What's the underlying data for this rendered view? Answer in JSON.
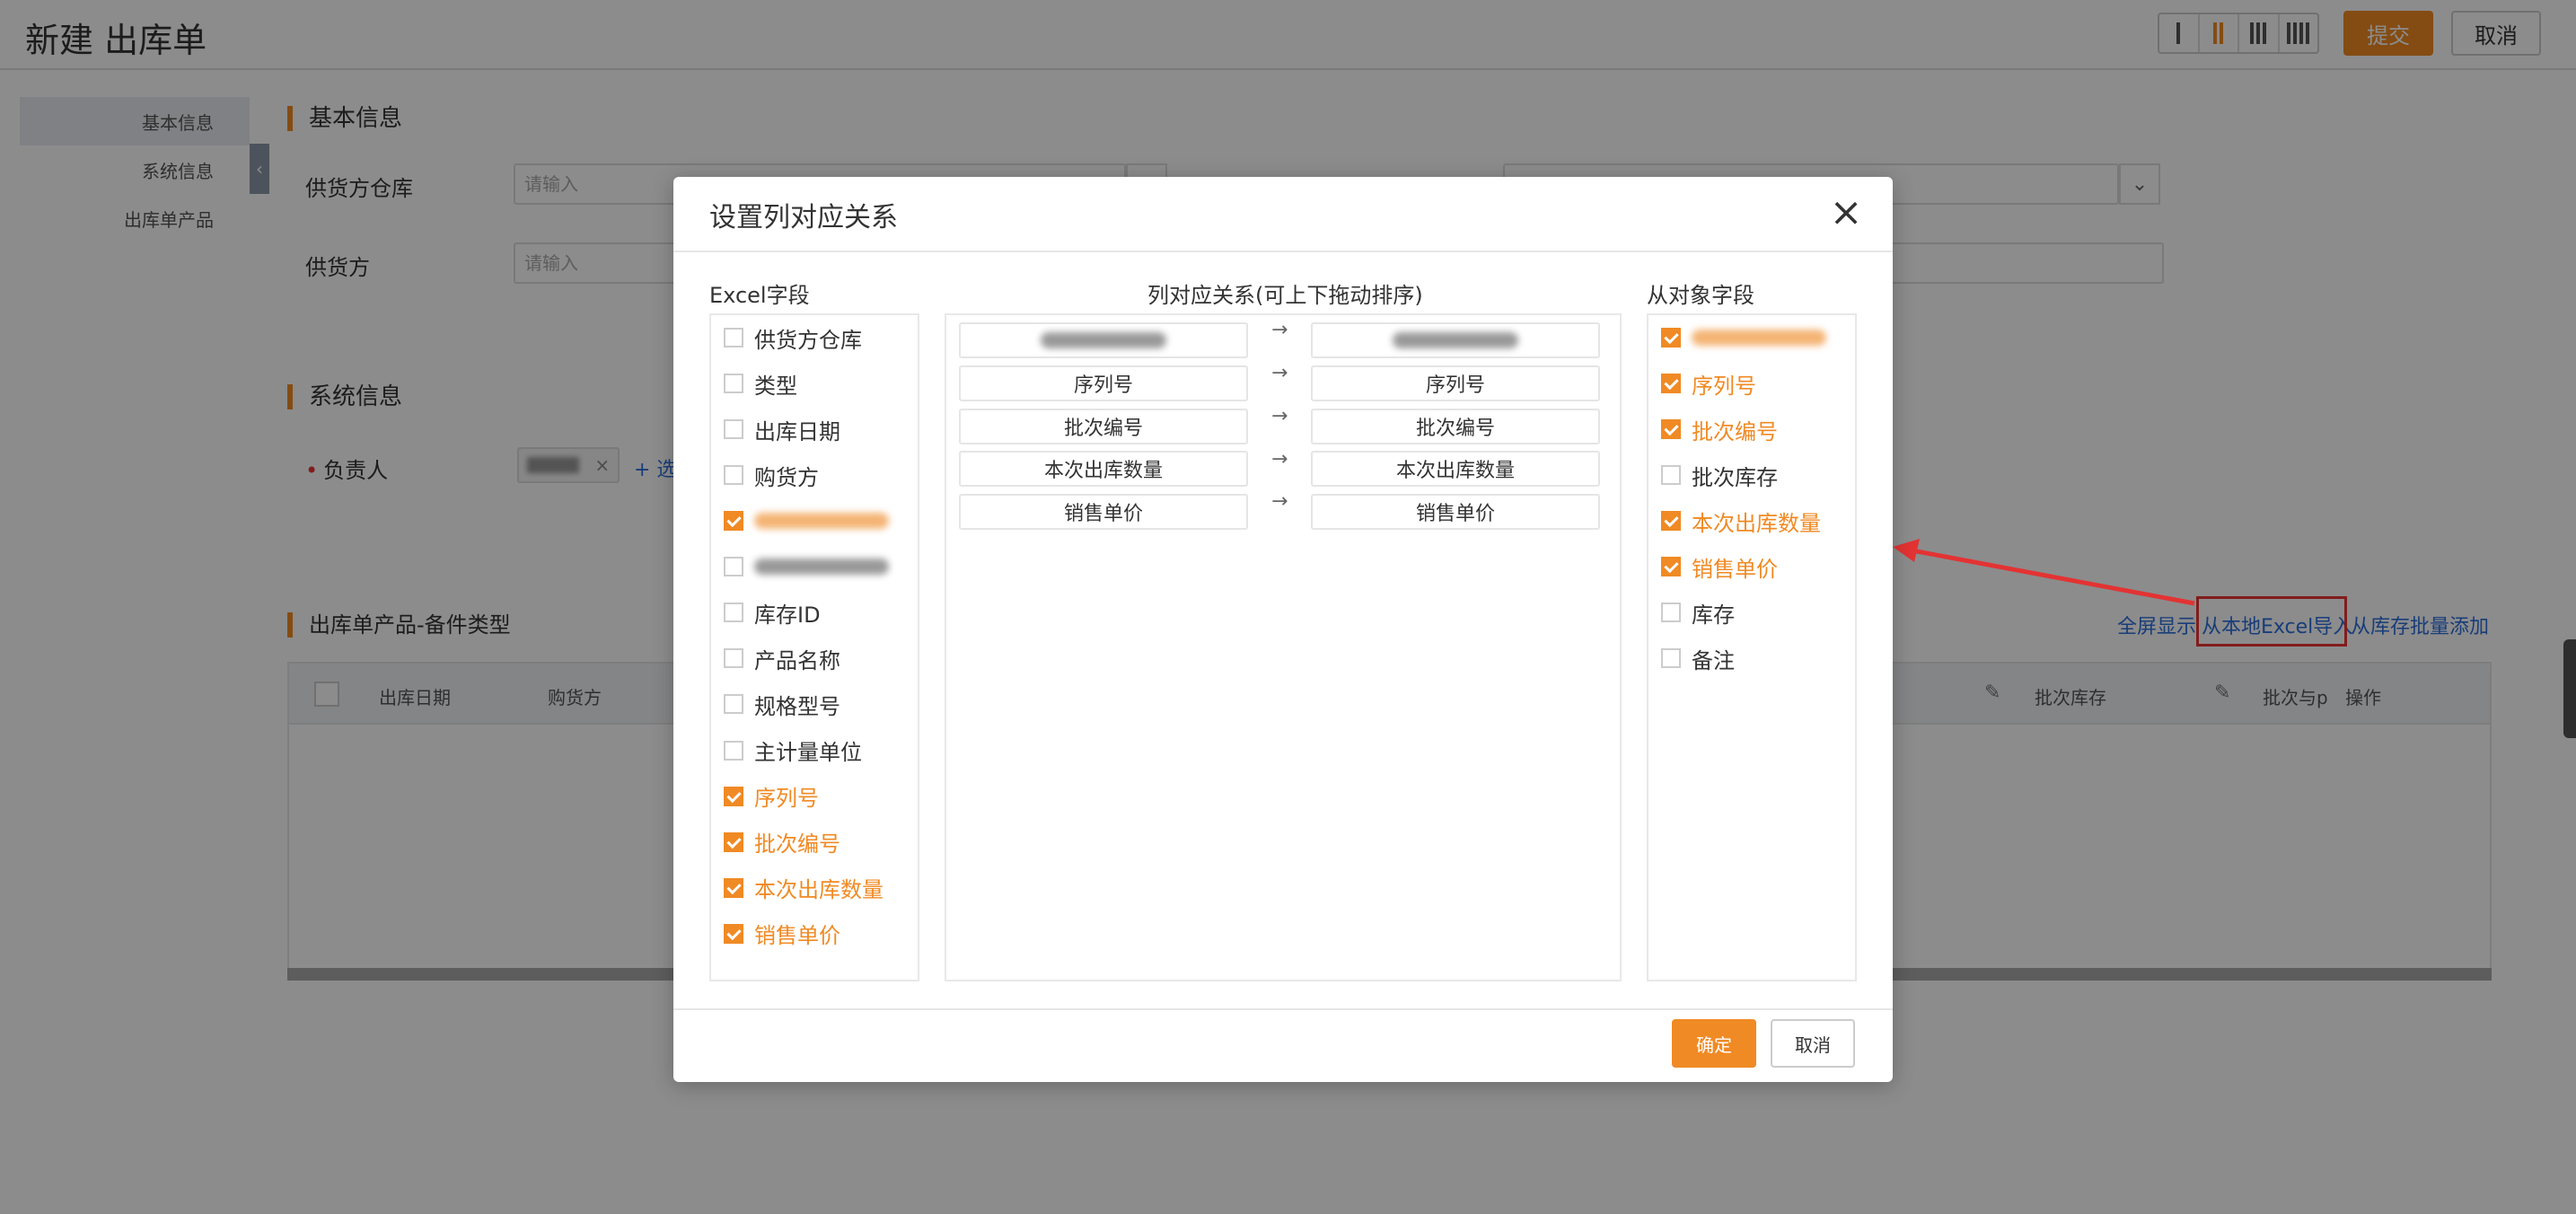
{
  "header": {
    "title": "新建 出库单",
    "submit_label": "提交",
    "cancel_label": "取消"
  },
  "side_nav": [
    "基本信息",
    "系统信息",
    "出库单产品"
  ],
  "collapse_icon": "‹",
  "sections": {
    "basic": "基本信息",
    "system": "系统信息",
    "products": "出库单产品-备件类型"
  },
  "form": {
    "supplier_warehouse_label": "供货方仓库",
    "supplier_label": "供货方",
    "placeholder": "请输入",
    "owner_label": "负责人",
    "required_mark": "•",
    "add_link": "+ 选",
    "tag_close": "×"
  },
  "product_links": {
    "fullscreen": "全屏显示",
    "import_excel": "从本地Excel导入",
    "batch_add": "从库存批量添加"
  },
  "table_headers": {
    "date": "出库日期",
    "buyer": "购货方",
    "batch_stock": "批次库存",
    "batch_and": "批次与p",
    "ops": "操作"
  },
  "modal": {
    "title": "设置列对应关系",
    "close_icon": "×",
    "excel_col_title": "Excel字段",
    "mapping_col_title": "列对应关系(可上下拖动排序)",
    "object_col_title": "从对象字段",
    "ok_label": "确定",
    "cancel_label": "取消",
    "arrow_icon": "→",
    "excel_fields": [
      {
        "label": "供货方仓库",
        "checked": false
      },
      {
        "label": "类型",
        "checked": false
      },
      {
        "label": "出库日期",
        "checked": false
      },
      {
        "label": "购货方",
        "checked": false
      },
      {
        "label": "",
        "checked": true
      },
      {
        "label": "",
        "checked": false
      },
      {
        "label": "库存ID",
        "checked": false
      },
      {
        "label": "产品名称",
        "checked": false
      },
      {
        "label": "规格型号",
        "checked": false
      },
      {
        "label": "主计量单位",
        "checked": false
      },
      {
        "label": "序列号",
        "checked": true
      },
      {
        "label": "批次编号",
        "checked": true
      },
      {
        "label": "本次出库数量",
        "checked": true
      },
      {
        "label": "销售单价",
        "checked": true
      }
    ],
    "mappings": [
      {
        "from": "",
        "to": ""
      },
      {
        "from": "序列号",
        "to": "序列号"
      },
      {
        "from": "批次编号",
        "to": "批次编号"
      },
      {
        "from": "本次出库数量",
        "to": "本次出库数量"
      },
      {
        "from": "销售单价",
        "to": "销售单价"
      }
    ],
    "object_fields": [
      {
        "label": "",
        "checked": true
      },
      {
        "label": "序列号",
        "checked": true
      },
      {
        "label": "批次编号",
        "checked": true
      },
      {
        "label": "批次库存",
        "checked": false
      },
      {
        "label": "本次出库数量",
        "checked": true
      },
      {
        "label": "销售单价",
        "checked": true
      },
      {
        "label": "库存",
        "checked": false
      },
      {
        "label": "备注",
        "checked": false
      }
    ]
  },
  "colors": {
    "accent": "#f08a24",
    "link": "#2c6fdc",
    "highlight": "#e33333"
  }
}
